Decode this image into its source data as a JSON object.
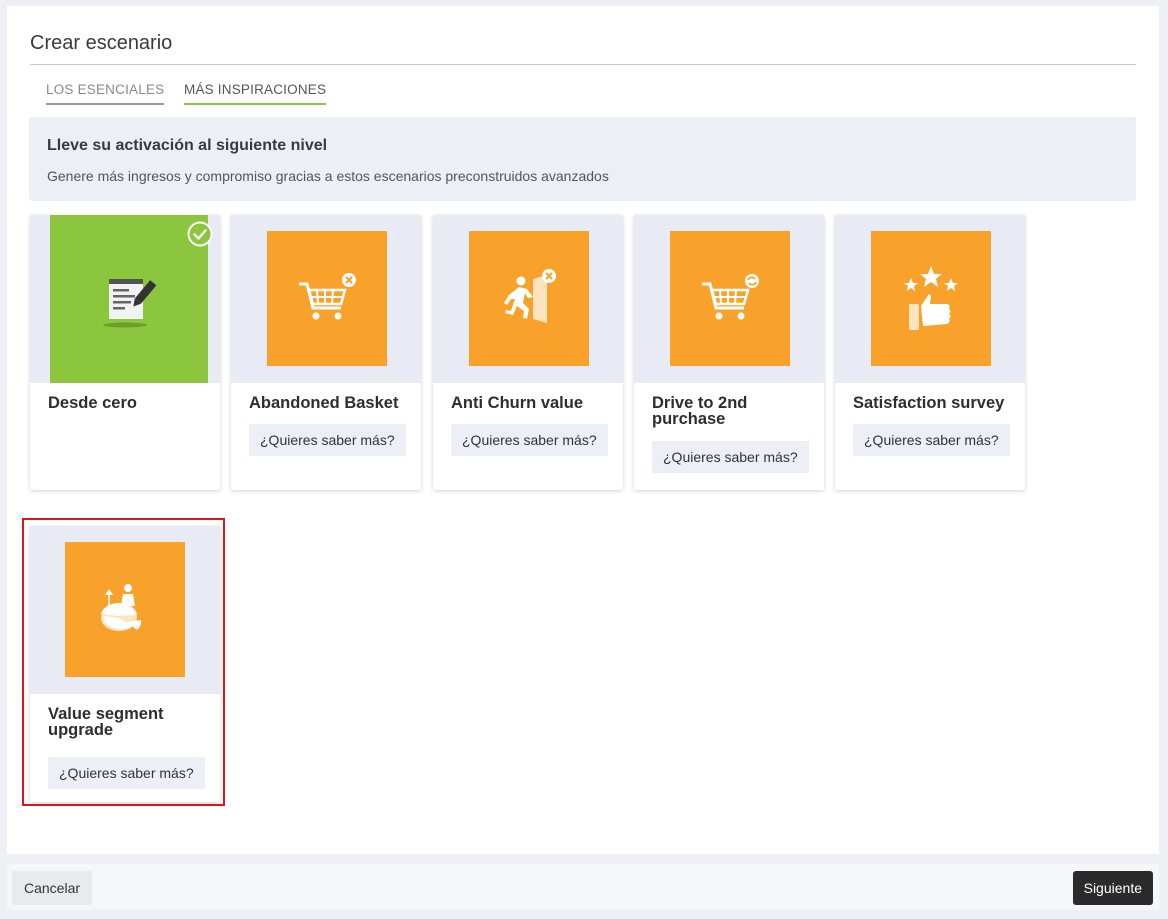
{
  "dialog": {
    "title": "Crear escenario",
    "tabs": [
      {
        "label": "LOS ESENCIALES",
        "active": false
      },
      {
        "label": "MÁS INSPIRACIONES",
        "active": true
      }
    ],
    "banner": {
      "title": "Lleve su activación al siguiente nivel",
      "subtitle": "Genere más ingresos y compromiso gracias a estos escenarios preconstruidos avanzados"
    },
    "cards": [
      {
        "title": "Desde cero",
        "icon": "document-edit-icon",
        "selected": true,
        "more": ""
      },
      {
        "title": "Abandoned Basket",
        "icon": "cart-remove-icon",
        "more": "¿Quieres saber más?"
      },
      {
        "title": "Anti Churn value",
        "icon": "exit-door-icon",
        "more": "¿Quieres saber más?"
      },
      {
        "title": "Drive to 2nd purchase",
        "icon": "cart-repeat-icon",
        "more": "¿Quieres saber más?"
      },
      {
        "title": "Satisfaction survey",
        "icon": "thumbs-up-stars-icon",
        "more": "¿Quieres saber más?"
      },
      {
        "title": "Value segment upgrade",
        "icon": "pie-segment-upgrade-icon",
        "more": "¿Quieres saber más?"
      }
    ],
    "colors": {
      "accent_green": "#8cc63f",
      "card_orange": "#f8a22b",
      "highlight_red": "#e0151b"
    }
  },
  "footer": {
    "cancel_label": "Cancelar",
    "next_label": "Siguiente"
  }
}
